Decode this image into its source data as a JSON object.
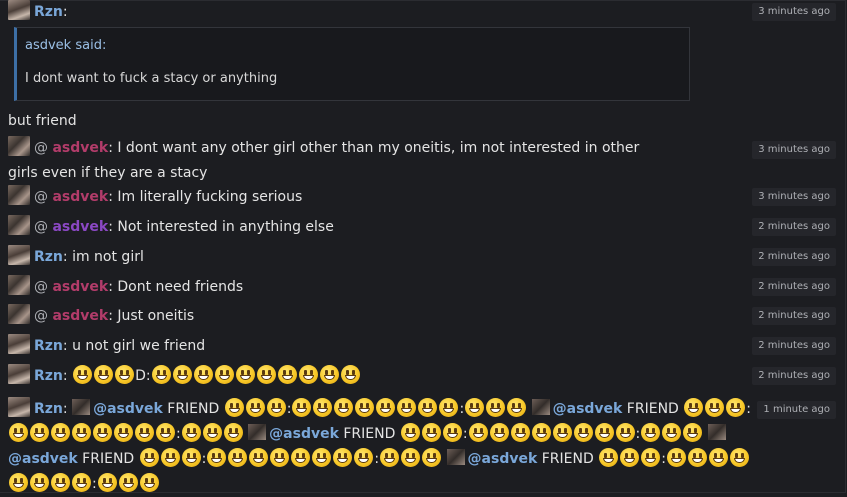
{
  "messages": {
    "m0": {
      "user": "Rzn",
      "sep": ":",
      "time": "3 minutes ago"
    },
    "quote": {
      "said": "asdvek said:",
      "text": "I dont want to fuck a stacy or anything"
    },
    "m1": {
      "text": "but friend"
    },
    "m2": {
      "at": "@ ",
      "user": "asdvek",
      "text": ": I dont want any other girl other than my oneitis, im not interested in other girls even if they are a stacy",
      "time": "3 minutes ago"
    },
    "m3": {
      "at": "@ ",
      "user": "asdvek",
      "text": ": Im literally fucking serious",
      "time": "3 minutes ago"
    },
    "m4": {
      "at": "@ ",
      "user": "asdvek",
      "text": ": Not interested in anything else",
      "time": "2 minutes ago"
    },
    "m5": {
      "user": "Rzn",
      "text": ": im not girl",
      "time": "2 minutes ago"
    },
    "m6": {
      "at": "@ ",
      "user": "asdvek",
      "text": ": Dont need friends",
      "time": "2 minutes ago"
    },
    "m7": {
      "at": "@ ",
      "user": "asdvek",
      "text": ": Just oneitis",
      "time": "2 minutes ago"
    },
    "m8": {
      "user": "Rzn",
      "text": ": u not girl we friend",
      "time": "2 minutes ago"
    },
    "m9": {
      "user": "Rzn",
      "sep": ":",
      "mid": "D:",
      "time": "2 minutes ago"
    },
    "m10": {
      "user": "Rzn",
      "sep": ":",
      "mention": "@asdvek",
      "friend": " FRIEND ",
      "colon": ":",
      "time": "1 minute ago"
    }
  },
  "colors": {
    "rzn": "#7aa7d9",
    "asdvek": "#b23c6a",
    "asdvek_alt": "#8b48c4",
    "background": "#1c1d21"
  },
  "icons": {
    "emoji": "grinning-face-icon",
    "avatar": "user-avatar"
  }
}
